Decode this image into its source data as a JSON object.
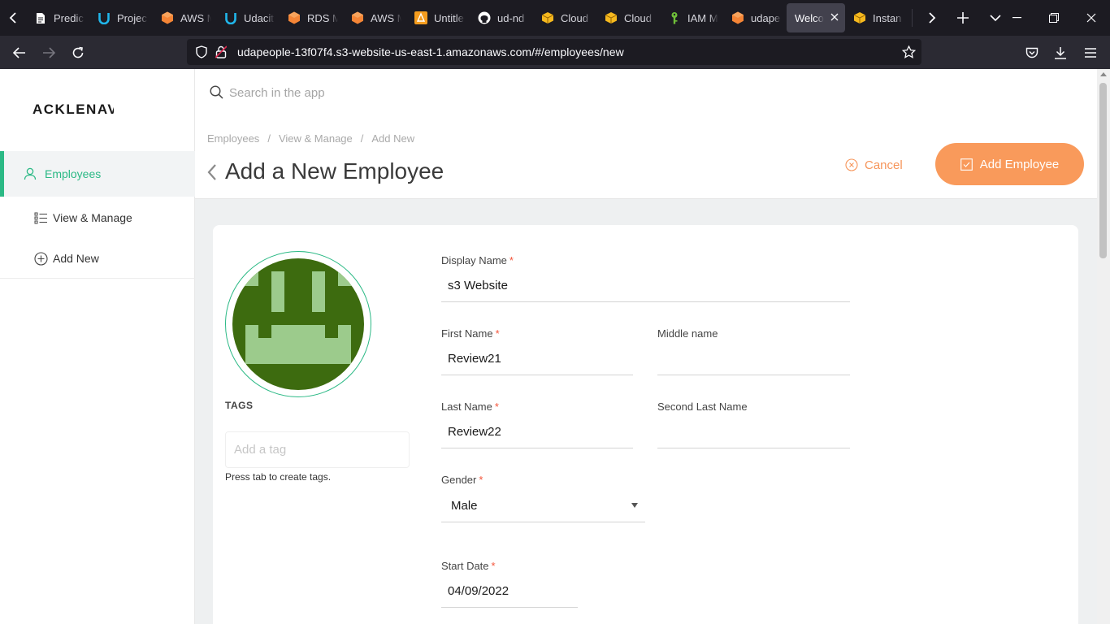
{
  "browser": {
    "tabs": [
      {
        "title": "Predic",
        "icon": "document-icon",
        "color": "#ffffff"
      },
      {
        "title": "Projec",
        "icon": "udacity-icon",
        "color": "#20b6ea"
      },
      {
        "title": "AWS M",
        "icon": "aws-icon",
        "color": "#f58536"
      },
      {
        "title": "Udacit",
        "icon": "udacity-icon",
        "color": "#20b6ea"
      },
      {
        "title": "RDS M",
        "icon": "aws-icon",
        "color": "#f58536"
      },
      {
        "title": "AWS M",
        "icon": "aws-icon",
        "color": "#f58536"
      },
      {
        "title": "Untitle",
        "icon": "diagram-icon",
        "color": "#f59d1e"
      },
      {
        "title": "ud-nd",
        "icon": "github-icon",
        "color": "#ffffff"
      },
      {
        "title": "Cloud",
        "icon": "cube-icon",
        "color": "#f5b81e"
      },
      {
        "title": "Cloud",
        "icon": "cube-icon",
        "color": "#f5b81e"
      },
      {
        "title": "IAM M",
        "icon": "key-icon",
        "color": "#6fbf3a"
      },
      {
        "title": "udape",
        "icon": "aws-icon",
        "color": "#f58536"
      },
      {
        "title": "Welcon",
        "icon": "none",
        "color": "#ffffff",
        "active": true
      },
      {
        "title": "Instan",
        "icon": "cube-icon",
        "color": "#f5b81e"
      }
    ],
    "url": "udapeople-13f07f4.s3-website-us-east-1.amazonaws.com/#/employees/new"
  },
  "sidebar": {
    "logo": "ACKLENAVENUE",
    "items": [
      {
        "label": "Employees",
        "icon": "user-icon",
        "active": true
      },
      {
        "label": "View & Manage",
        "icon": "list-icon",
        "active": false
      },
      {
        "label": "Add New",
        "icon": "plus-circle-icon",
        "active": false
      }
    ]
  },
  "search": {
    "placeholder": "Search in the app"
  },
  "header": {
    "breadcrumb": [
      "Employees",
      "View & Manage",
      "Add New"
    ],
    "title": "Add a New Employee",
    "cancel_label": "Cancel",
    "add_label": "Add Employee"
  },
  "profile": {
    "tags_label": "TAGS",
    "tag_placeholder": "Add a tag",
    "tag_hint": "Press tab to create tags."
  },
  "form": {
    "display_name": {
      "label": "Display Name",
      "value": "s3 Website",
      "required": true
    },
    "first_name": {
      "label": "First Name",
      "value": "Review21",
      "required": true
    },
    "middle_name": {
      "label": "Middle name",
      "value": "",
      "required": false
    },
    "last_name": {
      "label": "Last Name",
      "value": "Review22",
      "required": true
    },
    "second_last_name": {
      "label": "Second Last Name",
      "value": "",
      "required": false
    },
    "gender": {
      "label": "Gender",
      "value": "Male",
      "required": true
    },
    "start_date": {
      "label": "Start Date",
      "value": "04/09/2022",
      "required": true
    },
    "required_mark": "*"
  },
  "colors": {
    "accent_green": "#2bb985",
    "accent_orange": "#f99a5b",
    "avatar_dark": "#3d6b0f",
    "avatar_light": "#9ccb8c"
  }
}
